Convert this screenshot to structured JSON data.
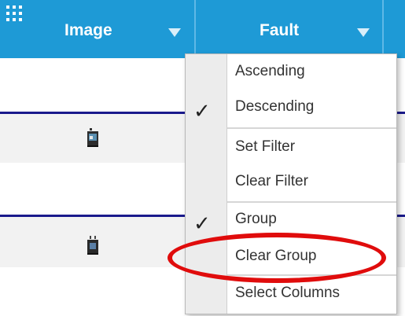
{
  "grid": {
    "columns": [
      {
        "label": "Image"
      },
      {
        "label": "Fault"
      }
    ]
  },
  "menu": {
    "items": [
      {
        "label": "Ascending",
        "checked": false
      },
      {
        "label": "Descending",
        "checked": true
      },
      {
        "label": "Set Filter",
        "checked": false
      },
      {
        "label": "Clear Filter",
        "checked": false
      },
      {
        "label": "Group",
        "checked": true
      },
      {
        "label": "Clear Group",
        "checked": false,
        "highlighted": true
      },
      {
        "label": "Select Columns",
        "checked": false
      }
    ],
    "check_glyph": "✓"
  },
  "colors": {
    "header": "#1e9ad6",
    "highlight": "#e00c0c",
    "row_line": "#1a1a8c"
  }
}
